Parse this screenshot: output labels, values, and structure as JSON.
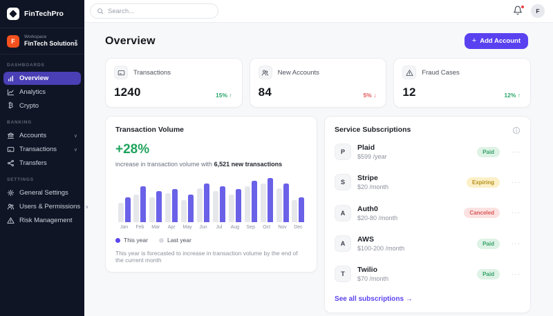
{
  "brand": {
    "name": "FinTechPro"
  },
  "workspace": {
    "label": "Workspace",
    "name": "FinTech Solutions",
    "avatar_letter": "F"
  },
  "sidebar": {
    "sections": [
      {
        "label": "DASHBOARDS",
        "items": [
          {
            "label": "Overview",
            "icon": "bar-chart",
            "active": true,
            "chevron": false
          },
          {
            "label": "Analytics",
            "icon": "line-chart",
            "active": false,
            "chevron": false
          },
          {
            "label": "Crypto",
            "icon": "bitcoin",
            "active": false,
            "chevron": false
          }
        ]
      },
      {
        "label": "BANKING",
        "items": [
          {
            "label": "Accounts",
            "icon": "bank",
            "active": false,
            "chevron": true
          },
          {
            "label": "Transactions",
            "icon": "card",
            "active": false,
            "chevron": true
          },
          {
            "label": "Transfers",
            "icon": "share",
            "active": false,
            "chevron": false
          }
        ]
      },
      {
        "label": "SETTINGS",
        "items": [
          {
            "label": "General Settings",
            "icon": "gear",
            "active": false,
            "chevron": false
          },
          {
            "label": "Users & Permissions",
            "icon": "users",
            "active": false,
            "chevron": true
          },
          {
            "label": "Risk Management",
            "icon": "alert",
            "active": false,
            "chevron": false
          }
        ]
      }
    ]
  },
  "topbar": {
    "search_placeholder": "Search...",
    "avatar_letter": "F"
  },
  "header": {
    "title": "Overview",
    "add_button": "Add Account",
    "add_plus": "+"
  },
  "stats": [
    {
      "label": "Transactions",
      "value": "1240",
      "trend": "15% ↑",
      "direction": "up",
      "icon": "card"
    },
    {
      "label": "New Accounts",
      "value": "84",
      "trend": "5% ↓",
      "direction": "down",
      "icon": "users"
    },
    {
      "label": "Fraud Cases",
      "value": "12",
      "trend": "12% ↑",
      "direction": "up",
      "icon": "alert"
    }
  ],
  "volume_card": {
    "title": "Transaction Volume",
    "highlight": "+28%",
    "subtitle_prefix": "increase in transaction volume with ",
    "subtitle_bold": "6,521 new transactions",
    "footnote": "This year is forecasted to increase in transaction volume by the end of the current month",
    "legend": [
      {
        "label": "This year",
        "color": "#5a45ee"
      },
      {
        "label": "Last year",
        "color": "#d9dbe1"
      }
    ]
  },
  "chart_data": {
    "type": "bar",
    "title": "Transaction Volume",
    "categories": [
      "Jan",
      "Feb",
      "Mar",
      "Apr",
      "May",
      "Jun",
      "Jul",
      "Aug",
      "Sep",
      "Oct",
      "Nov",
      "Dec"
    ],
    "series": [
      {
        "name": "This year",
        "color": "#6a61e8",
        "values": [
          57,
          82,
          70,
          75,
          63,
          88,
          82,
          75,
          94,
          100,
          88,
          57
        ]
      },
      {
        "name": "Last year",
        "color": "#e6e7eb",
        "values": [
          44,
          63,
          57,
          65,
          50,
          76,
          70,
          63,
          82,
          88,
          76,
          50
        ]
      }
    ],
    "ylim": [
      0,
      100
    ],
    "grid": false,
    "legend_position": "bottom",
    "bar_order_per_category": [
      "Last year",
      "This year"
    ]
  },
  "subscriptions": {
    "title": "Service Subscriptions",
    "items": [
      {
        "initial": "P",
        "name": "Plaid",
        "price": "$599 /year",
        "status": "Paid"
      },
      {
        "initial": "S",
        "name": "Stripe",
        "price": "$20 /month",
        "status": "Expiring"
      },
      {
        "initial": "A",
        "name": "Auth0",
        "price": "$20-80 /month",
        "status": "Canceled"
      },
      {
        "initial": "A",
        "name": "AWS",
        "price": "$100-200 /month",
        "status": "Paid"
      },
      {
        "initial": "T",
        "name": "Twilio",
        "price": "$70 /month",
        "status": "Paid"
      }
    ],
    "see_all": "See all subscriptions →",
    "status_colors": {
      "Paid": {
        "bg": "#def2e6",
        "text": "#34a268"
      },
      "Expiring": {
        "bg": "#fcf0c8",
        "text": "#b58f1c"
      },
      "Canceled": {
        "bg": "#fbe2e0",
        "text": "#d95858"
      }
    }
  }
}
